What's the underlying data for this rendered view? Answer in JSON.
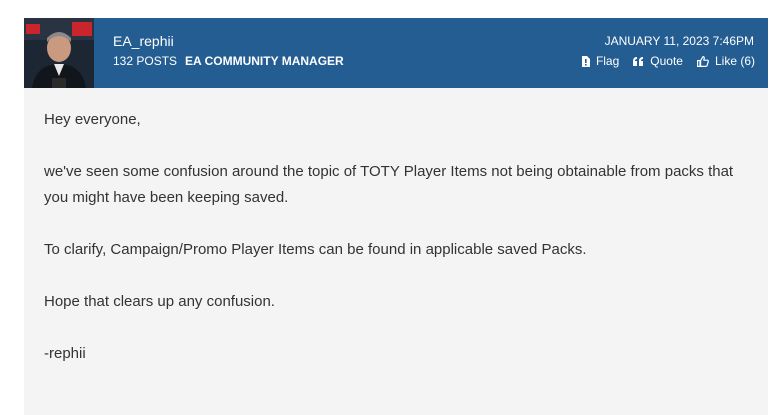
{
  "author": {
    "name": "EA_rephii",
    "posts": "132 POSTS",
    "rank": "EA COMMUNITY MANAGER"
  },
  "post": {
    "date": "JANUARY 11, 2023 7:46PM",
    "actions": {
      "flag_label": "Flag",
      "quote_label": "Quote",
      "like_label": "Like (6)"
    },
    "body": [
      "Hey everyone,",
      "we've seen some confusion around the topic of TOTY Player Items not being obtainable from packs that you might have been keeping saved.",
      "To clarify, Campaign/Promo Player Items can be found in applicable saved Packs.",
      "Hope that clears up any confusion.",
      "-rephii"
    ]
  },
  "colors": {
    "header_bg": "#245d91",
    "body_bg": "#f4f4f4",
    "body_text": "#333333"
  },
  "icons": {
    "flag": "flag-icon",
    "quote": "quote-icon",
    "like": "thumbs-up-icon"
  }
}
